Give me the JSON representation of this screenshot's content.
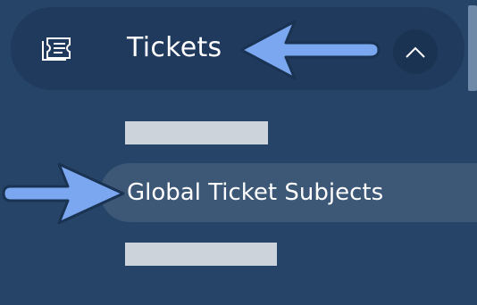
{
  "sidebar": {
    "group": {
      "title": "Tickets",
      "icon": "ticket-icon",
      "toggle_icon": "chevron-up-icon",
      "expanded": true
    },
    "sub_items": [
      {
        "label": "",
        "redacted": true
      },
      {
        "label": "Global Ticket Subjects",
        "active": true
      },
      {
        "label": "",
        "redacted": true
      }
    ]
  },
  "annotations": {
    "arrow_color": "#7aa7f0",
    "arrows": [
      "arrow-icon",
      "arrow-icon"
    ]
  },
  "colors": {
    "background": "#264468",
    "header_background": "#1f3a5c",
    "active_item_background": "#3d5777",
    "text": "#ffffff"
  }
}
